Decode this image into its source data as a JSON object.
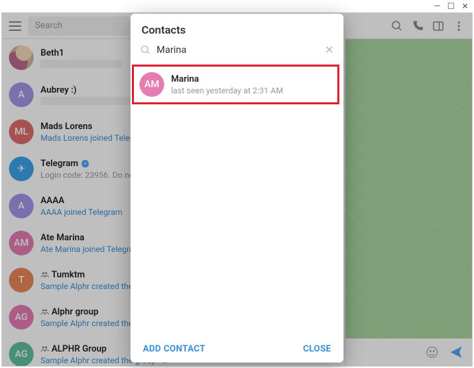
{
  "window": {
    "min": "—",
    "max": "☐",
    "close": "✕"
  },
  "header": {
    "search_placeholder": "Search"
  },
  "chats": [
    {
      "avatar_type": "img",
      "initials": "",
      "title": "Beth1",
      "sub": "",
      "sub_style": "placeholder",
      "group": false,
      "verified": false
    },
    {
      "avatar_type": "violet",
      "initials": "A",
      "title": "Aubrey :)",
      "sub": "",
      "sub_style": "placeholder wide",
      "group": false,
      "verified": false
    },
    {
      "avatar_type": "red",
      "initials": "ML",
      "title": "Mads Lorens",
      "sub": "Mads Lorens joined Teleg…",
      "sub_style": "",
      "group": false,
      "verified": false
    },
    {
      "avatar_type": "blue",
      "initials": "✈",
      "title": "Telegram",
      "sub": "Login code: 23956. Do no…",
      "sub_style": "gray",
      "group": false,
      "verified": true
    },
    {
      "avatar_type": "violet",
      "initials": "A",
      "title": "AAAA",
      "sub": "AAAA joined Telegram",
      "sub_style": "",
      "group": false,
      "verified": false
    },
    {
      "avatar_type": "pink",
      "initials": "AM",
      "title": "Ate Marina",
      "sub": "Ate Marina joined Telegra…",
      "sub_style": "",
      "group": false,
      "verified": false
    },
    {
      "avatar_type": "orange",
      "initials": "T",
      "title": "Tumktm",
      "sub": "Sample Alphr created the…",
      "sub_style": "",
      "group": true,
      "verified": false
    },
    {
      "avatar_type": "pink",
      "initials": "AG",
      "title": "Alphr group",
      "sub": "Sample Alphr created the…",
      "sub_style": "",
      "group": true,
      "verified": false
    },
    {
      "avatar_type": "teal",
      "initials": "AG",
      "title": "ALPHR Group",
      "sub": "Sample Alphr created the group «…",
      "sub_style": "",
      "group": true,
      "verified": false
    }
  ],
  "modal": {
    "title": "Contacts",
    "search_value": "Marina",
    "result": {
      "initials": "AM",
      "name": "Marina",
      "status": "last seen yesterday at 2:31 AM"
    },
    "add_label": "ADD CONTACT",
    "close_label": "CLOSE"
  }
}
